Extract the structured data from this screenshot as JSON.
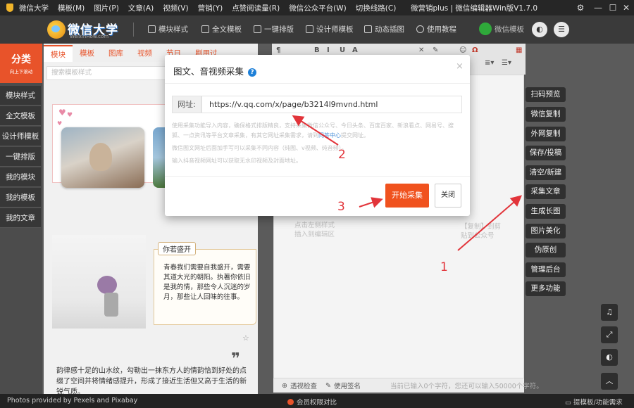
{
  "titlebar": {
    "menu": [
      "微信大学",
      "模板(M)",
      "图片(P)",
      "文章(A)",
      "视频(V)",
      "营销(Y)",
      "点赞阅读量(R)",
      "微信公众平台(W)",
      "切换线路(C)"
    ],
    "window_title": "微营销plus | 微信编辑器Win版V1.7.0",
    "controls": [
      "⚙",
      "—",
      "☐",
      "✕"
    ]
  },
  "toolbar": {
    "logo_name": "微信大学",
    "logo_sub": "WeixinHow.com",
    "items": [
      "模块样式",
      "全文模板",
      "一键排版",
      "设计师模板",
      "动态插图",
      "使用教程"
    ],
    "wechat_template": "微信模板",
    "theme_btn": "◐",
    "menu_btn": "☰"
  },
  "leftnav": {
    "category_title": "分类",
    "category_sub": "向上下滚动",
    "items": [
      "模块样式",
      "全文模板",
      "设计师模板",
      "一键排版",
      "我的模块",
      "我的模板",
      "我的文章"
    ]
  },
  "template_panel": {
    "tabs": [
      "模块",
      "模板",
      "图库",
      "视频",
      "节日",
      "刷用过"
    ],
    "search_placeholder": "搜索模板样式",
    "badge": "你若盛开",
    "poem": "青春我们需要自我盛开，需要其道大光的朝阳。执著你依旧是我的情，那些令人沉迷的岁月，那些让人回味的往事。",
    "bottom_text": "韵律感十足的山水纹，勾勒出一抹东方人的情韵恰到好处的点缀了空间并将情绪感提升，形成了接近生活但又高于生活的新锐气质。"
  },
  "editor": {
    "hint_left": [
      "点击左侧样式",
      "插入到编辑区"
    ],
    "hint_right": [
      "【复制】到剪",
      "贴到公众号"
    ],
    "footer_check": "透视检查",
    "footer_sign": "使用签名",
    "footer_count": "当前已输入0个字符，您还可以输入50000个字符。"
  },
  "right_buttons": [
    "扫码预览",
    "微信复制",
    "外网复制",
    "保存/投稿",
    "清空/新建",
    "采集文章",
    "生成长图",
    "图片美化",
    "伪原创",
    "管理后台",
    "更多功能"
  ],
  "side_icons": [
    "bell-icon",
    "expand-icon",
    "contrast-icon",
    "up-icon"
  ],
  "modal": {
    "title": "图文、音视频采集",
    "help": "?",
    "close": "×",
    "url_label": "网址:",
    "url_value": "https://v.qq.com/x/page/b3214l9mvnd.html",
    "note_line1": "使用采集功能导入内容，确保格式排版精良，支持采集微信公众号、今日头条、百度百家、新浪看点、网易号、搜狐、一点资讯等平台文章采集，有其它网址采集需求，请到",
    "note_link": "问答中心",
    "note_line1_end": "提交网址。",
    "note_line2": "微信图文网址后面加手写可以采集不同内容（纯图、v视频、纯音频）。",
    "note_line3": "输入抖音视频网址可以获取无水印视频及封面地址。",
    "start_button": "开始采集",
    "close_button": "关闭"
  },
  "annotations": {
    "numbers": [
      "1",
      "2",
      "3"
    ],
    "color": "#e2343a"
  },
  "statusbar": {
    "left": "Photos provided by Pexels and Pixabay",
    "center": "会员权限对比",
    "right": "提模板/功能需求"
  }
}
